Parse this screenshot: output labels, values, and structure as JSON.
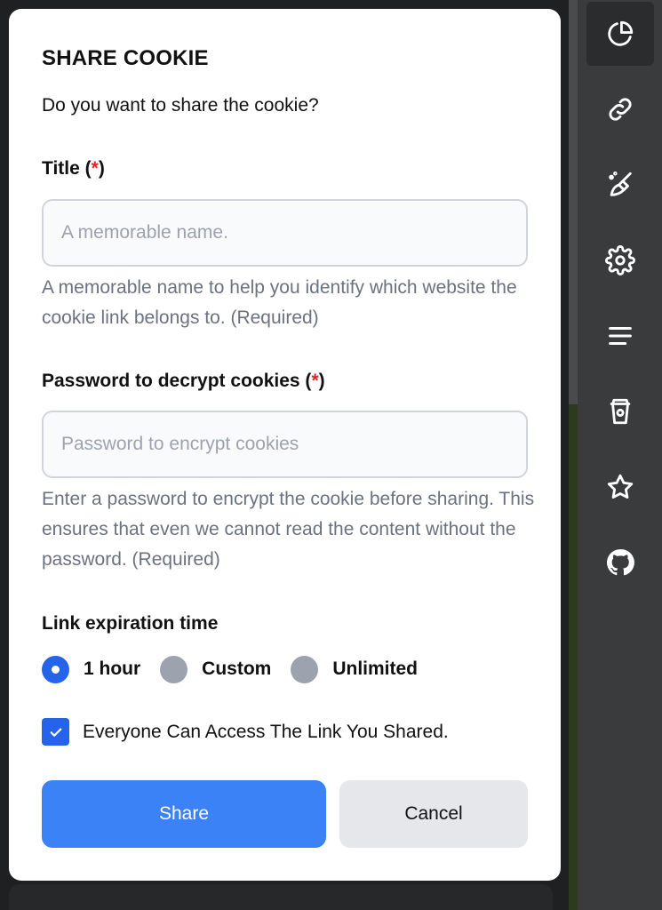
{
  "dialog": {
    "title": "SHARE COOKIE",
    "subtitle": "Do you want to share the cookie?",
    "title_field": {
      "label": "Title (",
      "required_mark": "*",
      "label_close": ")",
      "placeholder": "A memorable name.",
      "value": "",
      "help": "A memorable name to help you identify which website the cookie link belongs to. (Required)"
    },
    "password_field": {
      "label": "Password to decrypt cookies (",
      "required_mark": "*",
      "label_close": ")",
      "placeholder": "Password to encrypt cookies",
      "value": "",
      "help": "Enter a password to encrypt the cookie before sharing. This ensures that even we cannot read the content without the password. (Required)"
    },
    "expiration": {
      "label": "Link expiration time",
      "options": [
        {
          "label": "1 hour",
          "checked": true
        },
        {
          "label": "Custom",
          "checked": false
        },
        {
          "label": "Unlimited",
          "checked": false
        }
      ]
    },
    "public_access": {
      "label": "Everyone Can Access The Link You Shared.",
      "checked": true
    },
    "buttons": {
      "share": "Share",
      "cancel": "Cancel"
    }
  },
  "sidebar": {
    "items": [
      {
        "icon": "pie-chart-icon",
        "active": true
      },
      {
        "icon": "link-icon",
        "active": false
      },
      {
        "icon": "broom-clean-icon",
        "active": false
      },
      {
        "icon": "gear-icon",
        "active": false
      },
      {
        "icon": "menu-lines-icon",
        "active": false
      },
      {
        "icon": "coffee-cup-icon",
        "active": false
      },
      {
        "icon": "star-icon",
        "active": false
      },
      {
        "icon": "github-icon",
        "active": false
      }
    ]
  },
  "colors": {
    "accent": "#3b82f6",
    "radio_checked": "#2563eb",
    "required": "#e02424",
    "help_text": "#6b7280"
  }
}
